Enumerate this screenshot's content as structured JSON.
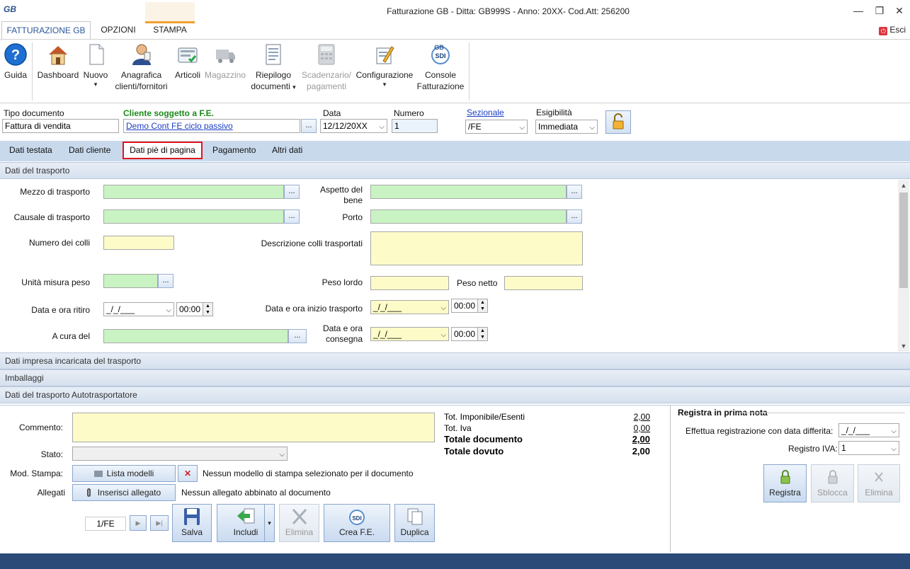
{
  "window": {
    "logo": "GB",
    "title": "Fatturazione GB - Ditta: GB999S - Anno: 20XX- Cod.Att: 256200",
    "minimize": "—",
    "restore": "❐",
    "close": "✕"
  },
  "ribbon_tabs": [
    "FATTURAZIONE GB",
    "OPZIONI",
    "STAMPA"
  ],
  "esci": {
    "icon": "⏻",
    "label": "Esci"
  },
  "ribbon": {
    "guida": "Guida",
    "dashboard": "Dashboard",
    "nuovo": "Nuovo",
    "anagrafica_1": "Anagrafica",
    "anagrafica_2": "clienti/fornitori",
    "articoli": "Articoli",
    "magazzino": "Magazzino",
    "riepilogo_1": "Riepilogo",
    "riepilogo_2": "documenti",
    "scadenzario_1": "Scadenzario/",
    "scadenzario_2": "pagamenti",
    "configurazione": "Configurazione",
    "console_1": "Console",
    "console_2": "Fatturazione",
    "dropdown_marker": "▾",
    "question_glyph": "?"
  },
  "header": {
    "tipo_label": "Tipo documento",
    "tipo_value": "Fattura di vendita",
    "cliente_label": "Cliente soggetto a F.E.",
    "cliente_value": "Demo Cont FE ciclo passivo",
    "data_label": "Data",
    "data_value": "12/12/20XX",
    "numero_label": "Numero",
    "numero_value": "1",
    "sezionale_label": "Sezionale",
    "sezionale_value": "/FE",
    "esigibilita_label": "Esigibilità",
    "esigibilita_value": "Immediata",
    "dots": "...",
    "arrow": "⌵"
  },
  "subtabs": [
    "Dati testata",
    "Dati cliente",
    "Dati piè di pagina",
    "Pagamento",
    "Altri dati"
  ],
  "transport": {
    "section_title": "Dati del trasporto",
    "mezzo": "Mezzo di trasporto",
    "aspetto_1": "Aspetto del",
    "aspetto_2": "bene",
    "causale": "Causale di trasporto",
    "porto": "Porto",
    "numero_colli": "Numero dei colli",
    "descrizione_colli": "Descrizione colli trasportati",
    "unita_peso": "Unità misura peso",
    "peso_lordo": "Peso lordo",
    "peso_netto": "Peso netto",
    "data_ritiro": "Data e ora ritiro",
    "data_inizio": "Data e ora inizio trasporto",
    "a_cura": "A cura del",
    "data_consegna_1": "Data e ora",
    "data_consegna_2": "consegna",
    "date_blank": "_/_/___",
    "time_value": "00:00",
    "spin_up": "▲",
    "spin_down": "▼"
  },
  "sections": {
    "impresa": "Dati impresa incaricata del trasporto",
    "imballaggi": "Imballaggi",
    "autotrasportatore": "Dati del trasporto Autotrasportatore"
  },
  "bottom": {
    "commento": "Commento:",
    "stato": "Stato:",
    "mod_stampa": "Mod. Stampa:",
    "lista_modelli": "Lista modelli",
    "nessun_modello": "Nessun modello di stampa selezionato per il documento",
    "allegati": "Allegati",
    "inserisci_allegato": "Inserisci allegato",
    "nessun_allegato": "Nessun allegato abbinato al documento",
    "nav_value": "1/FE",
    "nav_next": "▶",
    "nav_last": "▶|",
    "remove_glyph": "✕",
    "salva": "Salva",
    "includi": "Includi",
    "elimina": "Elimina",
    "crea_fe": "Crea F.E.",
    "duplica": "Duplica",
    "sdi": "SDI"
  },
  "totals": {
    "imponibile_label": "Tot. Imponibile/Esenti",
    "imponibile_value": "2,00",
    "iva_label": "Tot. Iva",
    "iva_value": "0,00",
    "documento_label": "Totale documento",
    "documento_value": "2,00",
    "dovuto_label": "Totale dovuto",
    "dovuto_value": "2,00"
  },
  "registra": {
    "title": "Registra in prima nota",
    "differita": "Effettua registrazione con data differita:",
    "differita_value": "_/_/___",
    "registro_iva": "Registro IVA:",
    "registro_value": "1",
    "registra_btn": "Registra",
    "sblocca_btn": "Sblocca",
    "elimina_btn": "Elimina"
  },
  "colors": {
    "accent": "#2b5797",
    "green_field": "#c9f3c3",
    "yellow_field": "#fdfcc9",
    "tab_highlight": "#e0141e",
    "statusbar": "#2b4a78"
  }
}
